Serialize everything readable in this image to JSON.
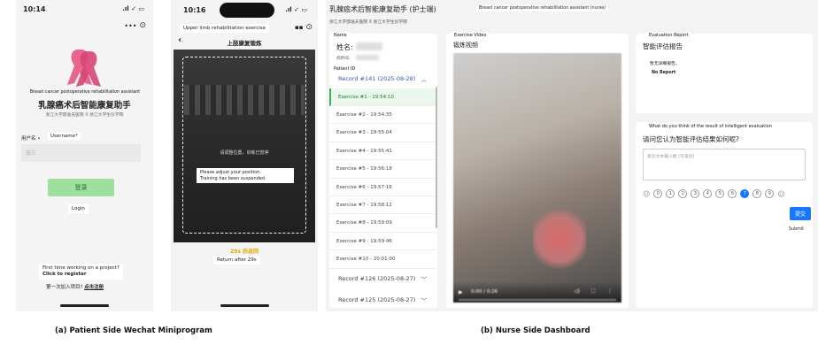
{
  "patient": {
    "status_time": "10:14",
    "status_icons": ".ıl ✓ ▭",
    "assistant_en": "Breast cancer postoperative rehabilitation assistant",
    "title_cn": "乳腺癌术后智能康复助手",
    "subtitle_cn": "浙江大学邵逸夫医院 X 浙江大学生仪学院",
    "username_cn": "用户名 •",
    "username_en": "Username*",
    "username_placeholder": "张三",
    "login_cn": "登录",
    "login_en": "Login",
    "first_time_en": "First time working on a project?",
    "click_register_en": "Click to register",
    "first_time_cn": "第一次加入项目?",
    "register_cn": "点击注册"
  },
  "exercise": {
    "status_time": "10:16",
    "status_icons": ".ıl ✓ ▭",
    "top_label_en": "Upper limb rehabilitation exercise",
    "title_cn": "上肢康复锻炼",
    "back": "‹",
    "overlay_cn": "请调整位置，训练已暂停",
    "overlay_en_1": "Please adjust your position.",
    "overlay_en_2": "Training has been suspended",
    "countdown_cn": "29s 后返回",
    "return_en": "Return after 29s"
  },
  "dashboard": {
    "title_cn": "乳腺癌术后智能康复助手 (护士端)",
    "title_en": "Breast cancer postoperative rehabilitation assistant (nurse)",
    "subtitle_cn": "浙江大学邵逸夫医院 X 浙江大学生仪学院",
    "name_tag": "Name",
    "name_cn": "姓名:",
    "case_cn": "病例号:",
    "patient_id": "Patient ID",
    "exercise_video_label": "Exercise Video",
    "video_title_cn": "锻炼视频",
    "video_time": "0:00 / 0:26",
    "eval_label": "Evaluation Report",
    "eval_title_cn": "智能评估报告",
    "no_report_cn": "暂无详细报告。",
    "no_report_en": "No Report",
    "question_en": "What do you think of the result of intelligent evaluation",
    "question_cn": "请问您认为智能评估结果如何呢?",
    "textarea_placeholder": "意见文本输入框 (可滚动)",
    "submit_cn": "提交",
    "submit_en": "Submit",
    "scores": [
      "0",
      "1",
      "2",
      "3",
      "4",
      "5",
      "6",
      "7",
      "8",
      "9"
    ],
    "selected_score": "7",
    "records_top": "Record #141 (2025-08-28)",
    "exercises": [
      "Exercise #1 - 19:54:10",
      "Exercise #2 - 19:54:35",
      "Exercise #3 - 19:55:04",
      "Exercise #4 - 19:55:41",
      "Exercise #5 - 19:56:18",
      "Exercise #6 - 19:57:16",
      "Exercise #7 - 19:58:12",
      "Exercise #8 - 19:59:09",
      "Exercise #9 - 19:59:46",
      "Exercise #10 - 20:01:00"
    ],
    "record_126": "Record #126 (2025-08-27)",
    "record_125": "Record #125 (2025-08-27)"
  },
  "captions": {
    "a": "(a) Patient Side Wechat Miniprogram",
    "b": "(b) Nurse Side Dashboard"
  },
  "colors": {
    "accent": "#3fae5b",
    "link_blue": "#2a5fb8",
    "submit_blue": "#1677ff"
  }
}
